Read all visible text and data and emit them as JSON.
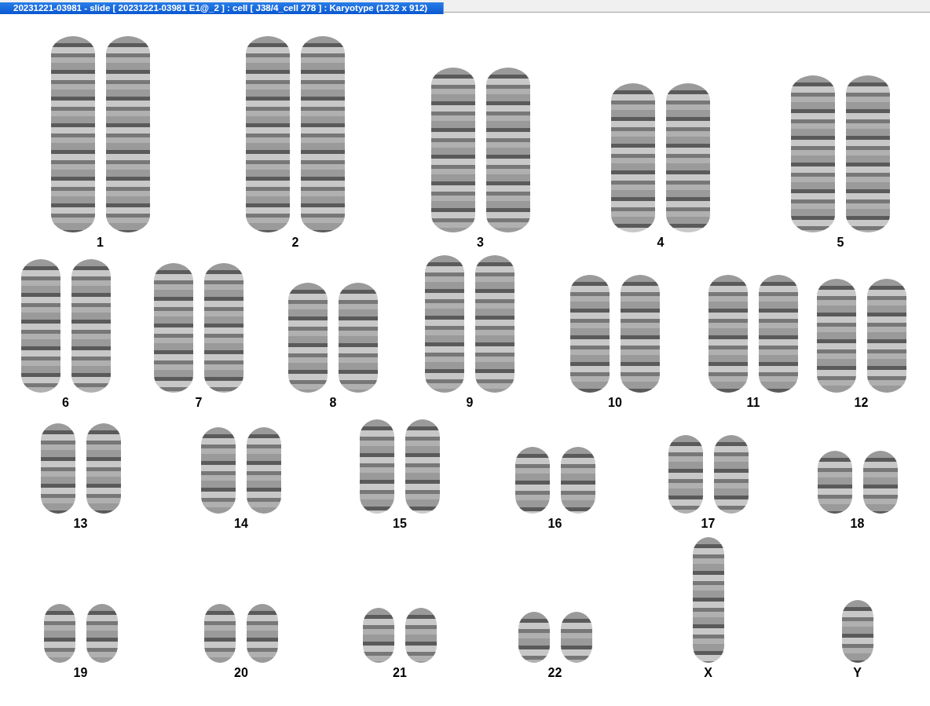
{
  "window": {
    "title": "20231221-03981 - slide [ 20231221-03981 E1@_2 ] : cell [ J38/4_cell 278 ] : Karyotype  (1232 x 912)"
  },
  "karyotype": {
    "rows": [
      [
        {
          "label": "1",
          "kind": "pair"
        },
        {
          "label": "2",
          "kind": "pair"
        },
        {
          "label": "3",
          "kind": "pair"
        },
        {
          "label": "4",
          "kind": "pair"
        },
        {
          "label": "5",
          "kind": "pair"
        }
      ],
      [
        {
          "label": "6",
          "kind": "pair"
        },
        {
          "label": "7",
          "kind": "pair"
        },
        {
          "label": "8",
          "kind": "pair"
        },
        {
          "label": "9",
          "kind": "pair"
        },
        {
          "label": "10",
          "kind": "pair"
        },
        {
          "label": "11",
          "kind": "pair"
        },
        {
          "label": "12",
          "kind": "pair"
        }
      ],
      [
        {
          "label": "13",
          "kind": "pair"
        },
        {
          "label": "14",
          "kind": "pair"
        },
        {
          "label": "15",
          "kind": "pair"
        },
        {
          "label": "16",
          "kind": "pair"
        },
        {
          "label": "17",
          "kind": "pair"
        },
        {
          "label": "18",
          "kind": "pair"
        }
      ],
      [
        {
          "label": "19",
          "kind": "pair"
        },
        {
          "label": "20",
          "kind": "pair"
        },
        {
          "label": "21",
          "kind": "pair"
        },
        {
          "label": "22",
          "kind": "pair"
        },
        {
          "label": "X",
          "kind": "single"
        },
        {
          "label": "Y",
          "kind": "single"
        }
      ]
    ]
  }
}
